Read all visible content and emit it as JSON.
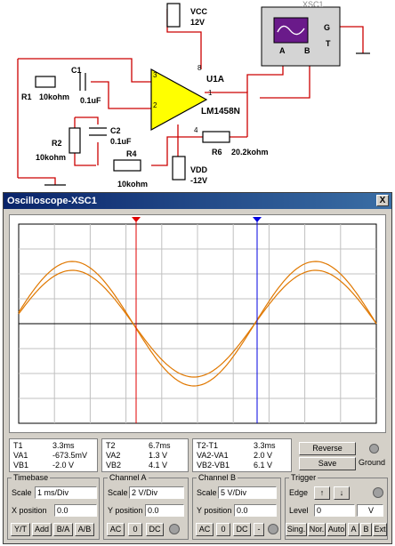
{
  "circuit": {
    "vcc_name": "VCC",
    "vcc_value": "12V",
    "vdd_name": "VDD",
    "vdd_value": "-12V",
    "scope_ref": "XSC1",
    "scope_pin_g": "G",
    "scope_pin_t": "T",
    "scope_pin_a": "A",
    "scope_pin_b": "B",
    "opamp_ref": "U1A",
    "opamp_part": "LM1458N",
    "pin3": "3",
    "pin8": "8",
    "pin2": "2",
    "pin1": "1",
    "pin4": "4",
    "r1_ref": "R1",
    "r1_value": "10kohm",
    "c1_ref": "C1",
    "c1_value": "0.1uF",
    "r2_ref": "R2",
    "r2_value": "10kohm",
    "c2_ref": "C2",
    "c2_value": "0.1uF",
    "r4_ref": "R4",
    "r4_value": "10kohm",
    "r6_ref": "R6",
    "r6_value": "20.2kohm"
  },
  "scope": {
    "title": "Oscilloscope-XSC1",
    "close_label": "X",
    "cursor1_color": "#e00000",
    "cursor2_color": "#0000e0",
    "trace_color": "#e07800",
    "readout": {
      "t1": {
        "label": "T1",
        "value": "3.3ms"
      },
      "va1": {
        "label": "VA1",
        "value": "-673.5mV"
      },
      "vb1": {
        "label": "VB1",
        "value": "-2.0 V"
      },
      "t2": {
        "label": "T2",
        "value": "6.7ms"
      },
      "va2": {
        "label": "VA2",
        "value": "1.3 V"
      },
      "vb2": {
        "label": "VB2",
        "value": "4.1 V"
      },
      "dt": {
        "label": "T2-T1",
        "value": "3.3ms"
      },
      "dva": {
        "label": "VA2-VA1",
        "value": "2.0 V"
      },
      "dvb": {
        "label": "VB2-VB1",
        "value": "6.1 V"
      }
    },
    "reverse_label": "Reverse",
    "save_label": "Save",
    "ground_label": "Ground",
    "timebase": {
      "title": "Timebase",
      "scale_label": "Scale",
      "scale_value": "1 ms/Div",
      "xpos_label": "X position",
      "xpos_value": "0.0",
      "modes": [
        "Y/T",
        "Add",
        "B/A",
        "A/B"
      ]
    },
    "channel_a": {
      "title": "Channel A",
      "scale_label": "Scale",
      "scale_value": "2 V/Div",
      "ypos_label": "Y position",
      "ypos_value": "0.0",
      "coupling": [
        "AC",
        "0",
        "DC"
      ]
    },
    "channel_b": {
      "title": "Channel B",
      "scale_label": "Scale",
      "scale_value": "5 V/Div",
      "ypos_label": "Y position",
      "ypos_value": "0.0",
      "coupling": [
        "AC",
        "0",
        "DC",
        "-"
      ]
    },
    "trigger": {
      "title": "Trigger",
      "edge_label": "Edge",
      "level_label": "Level",
      "level_value": "0",
      "level_unit": "V",
      "modes": [
        "Sing.",
        "Nor.",
        "Auto",
        "A",
        "B",
        "Ext"
      ]
    }
  }
}
